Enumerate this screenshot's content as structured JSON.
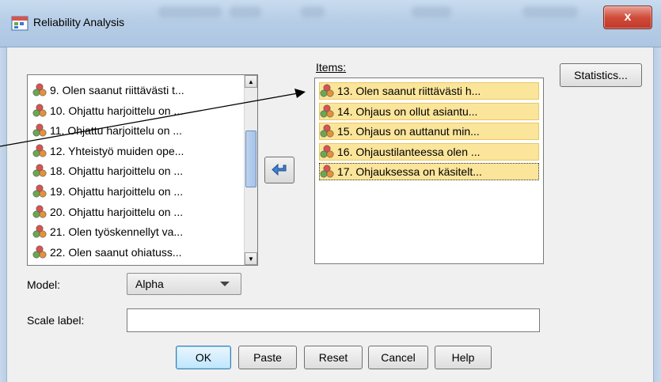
{
  "window": {
    "title": "Reliability Analysis",
    "close_label": "x"
  },
  "source_list": {
    "items": [
      "9. Olen saanut riittävästi t...",
      "10. Ohjattu harjoittelu on ...",
      "11. Ohjattu harjoittelu on ...",
      "12. Yhteistyö muiden ope...",
      "18. Ohjattu harjoittelu on ...",
      "19. Ohjattu harjoittelu on ...",
      "20. Ohjattu harjoittelu on ...",
      "21. Olen työskennellyt va...",
      "22. Olen saanut ohiatuss..."
    ]
  },
  "items_panel": {
    "label": "Items:",
    "items": [
      "13. Olen saanut riittävästi h...",
      "14. Ohjaus on ollut asiantu...",
      "15. Ohjaus on auttanut min...",
      "16. Ohjaustilanteessa olen ...",
      "17. Ohjauksessa on käsitelt..."
    ]
  },
  "statistics_button": "Statistics...",
  "model": {
    "label": "Model:",
    "value": "Alpha"
  },
  "scale_label": {
    "label": "Scale label:",
    "value": ""
  },
  "buttons": {
    "ok": "OK",
    "paste": "Paste",
    "reset": "Reset",
    "cancel": "Cancel",
    "help": "Help"
  },
  "icons": {
    "variable": "scale-variable-icon",
    "move": "arrow-left-icon",
    "app": "spss-dialog-icon"
  }
}
